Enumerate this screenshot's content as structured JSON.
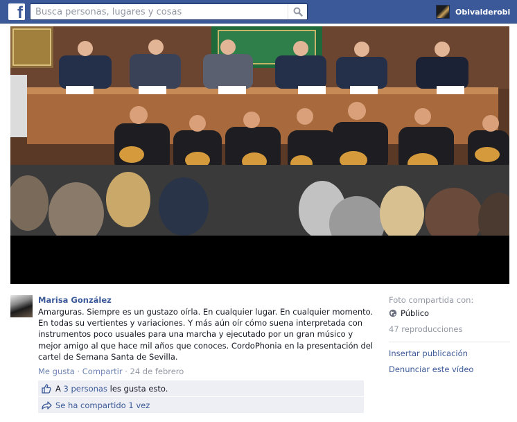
{
  "topbar": {
    "logo_letter": "f",
    "search_placeholder": "Busca personas, lugares y cosas",
    "profile_name": "Obivalderobi"
  },
  "post": {
    "author": "Marisa González",
    "text": "Amarguras. Siempre es un gustazo oírla. En cualquier lugar. En cualquier momento. En todas su vertientes y variaciones. Y más aún oír cómo suena interpretada con instrumentos poco usuales para una marcha y ejecutado por un gran músico y mejor amigo al que hace mil años que conoces. CordoPhonia en la presentación del cartel de Semana Santa de Sevilla.",
    "actions": {
      "like": "Me gusta",
      "share": "Compartir",
      "separator": "·",
      "date": "24 de febrero"
    },
    "likes": {
      "prefix": "A",
      "people": "3 personas",
      "suffix": "les gusta esto."
    },
    "shares": "Se ha compartido 1 vez"
  },
  "sidebar": {
    "shared_with_label": "Foto compartida con:",
    "privacy": "Público",
    "plays": "47 reproducciones",
    "embed": "Insertar publicación",
    "report": "Denunciar este vídeo"
  },
  "colors": {
    "brand": "#3b5998",
    "link": "#3b5998",
    "muted": "#9197a3",
    "panel": "#edeff4"
  }
}
